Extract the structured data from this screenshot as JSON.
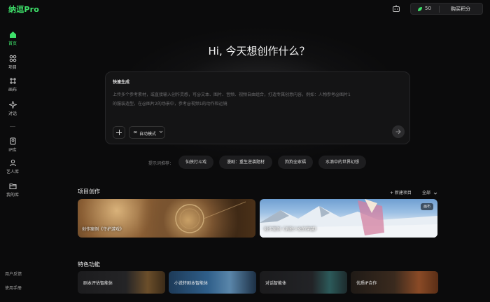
{
  "app": {
    "logo": "纳逗Pro"
  },
  "topbar": {
    "credits": "50",
    "buy_label": "购买积分"
  },
  "sidebar": {
    "items": [
      {
        "label": "首页",
        "icon": "home-icon"
      },
      {
        "label": "项目",
        "icon": "grid-icon"
      },
      {
        "label": "画布",
        "icon": "canvas-icon"
      },
      {
        "label": "对话",
        "icon": "sparkle-icon"
      },
      {
        "label": "IP库",
        "icon": "ip-library-icon"
      },
      {
        "label": "艺人库",
        "icon": "person-icon"
      },
      {
        "label": "我的库",
        "icon": "folder-icon"
      }
    ],
    "bottom": [
      "用户反馈",
      "使用手册"
    ]
  },
  "hero": {
    "title": "Hi, 今天想创作什么？"
  },
  "composer": {
    "mode_label": "快速生成",
    "placeholder_line1": "上传多个参考素材，或直接输入创作灵感，可@文本、图片、音频、视频自由组合，打造专属创意内容。例如：人物参考@图片1",
    "placeholder_line2": "的服装造型，在@图片2的场景中，参考@视频1的动作和运镜",
    "auto_label": "自动模式"
  },
  "suggestions": {
    "label": "提示词推荐：",
    "chips": [
      "仙侠打斗戏",
      "漫剧：重生逆袭题材",
      "狗狗全家福",
      "水滴中的世界幻想"
    ]
  },
  "projects": {
    "title": "项目创作",
    "new_label": "+ 新建项目",
    "all_label": "全部",
    "cards": [
      {
        "caption": "创作案例《守护游戏》"
      },
      {
        "caption": "创作案例《消影少女的穿越》",
        "badge": "画布"
      }
    ]
  },
  "features": {
    "title": "特色功能",
    "items": [
      "剧本评估智能体",
      "小说转剧本智能体",
      "对话智能体",
      "优质IP合作"
    ]
  },
  "colors": {
    "accent": "#3ee06a",
    "background": "#0b0b0c"
  }
}
